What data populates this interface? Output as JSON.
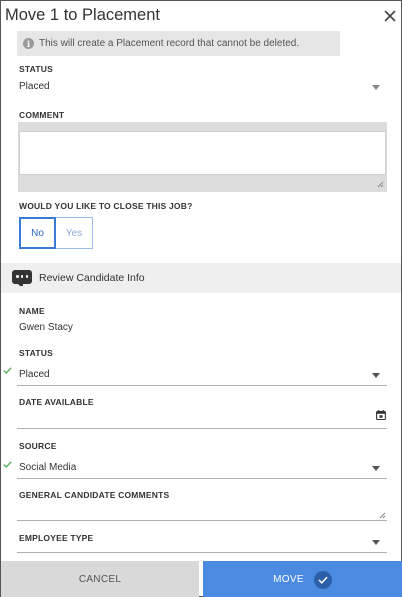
{
  "header": {
    "title": "Move 1 to Placement",
    "close_icon": "close-icon"
  },
  "info": {
    "icon": "info-icon",
    "text": "This will create a Placement record that cannot be deleted."
  },
  "placement": {
    "status_label": "STATUS",
    "status_value": "Placed",
    "comment_label": "COMMENT",
    "comment_value": "",
    "close_job_label": "WOULD YOU LIKE TO CLOSE THIS JOB?",
    "close_job_options": [
      "No",
      "Yes"
    ],
    "close_job_selected": "No"
  },
  "review": {
    "icon": "speech-bubble-icon",
    "title": "Review Candidate Info",
    "name_label": "NAME",
    "name_value": "Gwen Stacy",
    "status_label": "STATUS",
    "status_value": "Placed",
    "date_label": "DATE AVAILABLE",
    "date_value": "",
    "source_label": "SOURCE",
    "source_value": "Social Media",
    "comments_label": "GENERAL CANDIDATE COMMENTS",
    "comments_value": "",
    "employee_type_label": "EMPLOYEE TYPE",
    "employee_type_value": ""
  },
  "footer": {
    "cancel_label": "CANCEL",
    "move_label": "MOVE"
  },
  "colors": {
    "accent": "#4a8ae0",
    "accent_dark": "#2d5fa8",
    "check_green": "#4caf50",
    "info_bg": "#e6e6e6",
    "section_bg": "#efefef"
  }
}
